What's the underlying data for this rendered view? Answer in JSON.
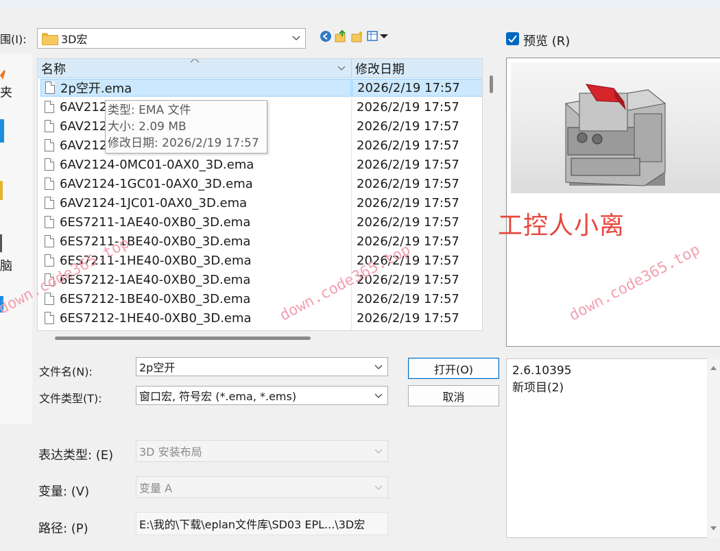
{
  "look_in": {
    "label": "围(I):",
    "value": "3D宏"
  },
  "places": [
    {
      "label": "夹"
    },
    {
      "label": "脑"
    }
  ],
  "file_list": {
    "columns": {
      "name": "名称",
      "date": "修改日期"
    },
    "rows": [
      {
        "name": "2p空开.ema",
        "date": "2026/2/19 17:57"
      },
      {
        "name": "6AV212",
        "date": "2026/2/19 17:57"
      },
      {
        "name": "6AV212",
        "date": "2026/2/19 17:57"
      },
      {
        "name": "6AV212",
        "date": "2026/2/19 17:57"
      },
      {
        "name": "6AV2124-0MC01-0AX0_3D.ema",
        "date": "2026/2/19 17:57"
      },
      {
        "name": "6AV2124-1GC01-0AX0_3D.ema",
        "date": "2026/2/19 17:57"
      },
      {
        "name": "6AV2124-1JC01-0AX0_3D.ema",
        "date": "2026/2/19 17:57"
      },
      {
        "name": "6ES7211-1AE40-0XB0_3D.ema",
        "date": "2026/2/19 17:57"
      },
      {
        "name": "6ES7211-1BE40-0XB0_3D.ema",
        "date": "2026/2/19 17:57"
      },
      {
        "name": "6ES7211-1HE40-0XB0_3D.ema",
        "date": "2026/2/19 17:57"
      },
      {
        "name": "6ES7212-1AE40-0XB0_3D.ema",
        "date": "2026/2/19 17:57"
      },
      {
        "name": "6ES7212-1BE40-0XB0_3D.ema",
        "date": "2026/2/19 17:57"
      },
      {
        "name": "6ES7212-1HE40-0XB0_3D.ema",
        "date": "2026/2/19 17:57"
      }
    ]
  },
  "tooltip": {
    "type": "类型: EMA 文件",
    "size": "大小: 2.09 MB",
    "modified": "修改日期: 2026/2/19 17:57"
  },
  "form": {
    "filename_label": "文件名(N):",
    "filename_value": "2p空开",
    "filetype_label": "文件类型(T):",
    "filetype_value": "窗口宏, 符号宏 (*.ema, *.ems)",
    "open_label": "打开(O)",
    "cancel_label": "取消",
    "repr_label": "表达类型: (E)",
    "repr_value": "3D 安装布局",
    "variant_label": "变量: (V)",
    "variant_value": "变量 A",
    "path_label": "路径: (P)",
    "path_value": "E:\\我的\\下载\\eplan文件库\\SD03  EPL...\\3D宏"
  },
  "preview": {
    "label": "预览 (R)",
    "checked": true,
    "info_line1": "2.6.10395",
    "info_line2": "新项目(2)"
  },
  "watermarks": {
    "brand": "工控人小离",
    "site": "down.code365.top"
  },
  "colors": {
    "selection": "#cce8ff",
    "header": "#d9ebf8",
    "accent": "#0067c0",
    "watermark_red": "#e8463c",
    "watermark_pink": "#f2a1b3"
  }
}
